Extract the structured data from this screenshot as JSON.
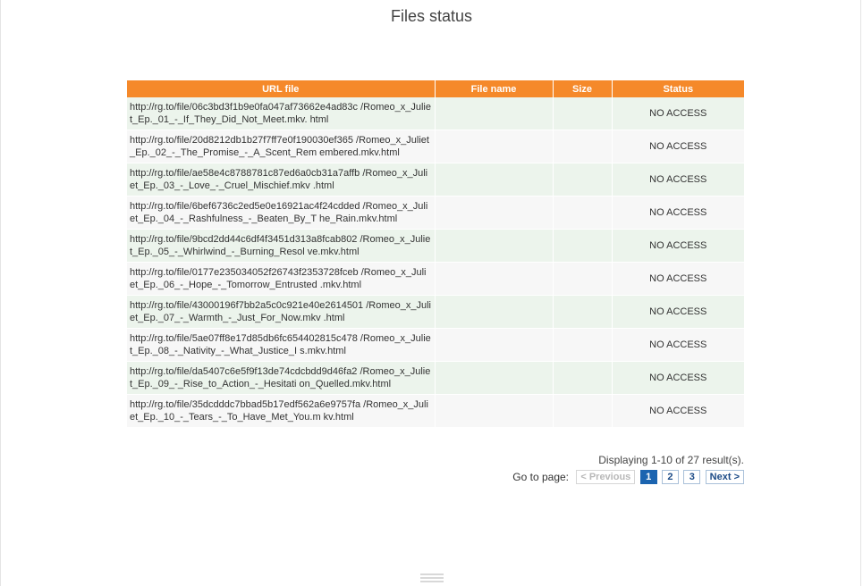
{
  "page": {
    "title": "Files status"
  },
  "table": {
    "headers": {
      "url": "URL file",
      "name": "File name",
      "size": "Size",
      "status": "Status"
    },
    "rows": [
      {
        "url": "http://rg.to/file/06c3bd3f1b9e0fa047af73662e4ad83c /Romeo_x_Juliet_Ep._01_-_If_They_Did_Not_Meet.mkv. html",
        "name": "",
        "size": "",
        "status": "NO ACCESS"
      },
      {
        "url": "http://rg.to/file/20d8212db1b27f7ff7e0f190030ef365 /Romeo_x_Juliet_Ep._02_-_The_Promise_-_A_Scent_Rem embered.mkv.html",
        "name": "",
        "size": "",
        "status": "NO ACCESS"
      },
      {
        "url": "http://rg.to/file/ae58e4c8788781c87ed6a0cb31a7affb /Romeo_x_Juliet_Ep._03_-_Love_-_Cruel_Mischief.mkv .html",
        "name": "",
        "size": "",
        "status": "NO ACCESS"
      },
      {
        "url": "http://rg.to/file/6bef6736c2ed5e0e16921ac4f24cdded /Romeo_x_Juliet_Ep._04_-_Rashfulness_-_Beaten_By_T he_Rain.mkv.html",
        "name": "",
        "size": "",
        "status": "NO ACCESS"
      },
      {
        "url": "http://rg.to/file/9bcd2dd44c6df4f3451d313a8fcab802 /Romeo_x_Juliet_Ep._05_-_Whirlwind_-_Burning_Resol ve.mkv.html",
        "name": "",
        "size": "",
        "status": "NO ACCESS"
      },
      {
        "url": "http://rg.to/file/0177e235034052f26743f2353728fceb /Romeo_x_Juliet_Ep._06_-_Hope_-_Tomorrow_Entrusted .mkv.html",
        "name": "",
        "size": "",
        "status": "NO ACCESS"
      },
      {
        "url": "http://rg.to/file/43000196f7bb2a5c0c921e40e2614501 /Romeo_x_Juliet_Ep._07_-_Warmth_-_Just_For_Now.mkv .html",
        "name": "",
        "size": "",
        "status": "NO ACCESS"
      },
      {
        "url": "http://rg.to/file/5ae07ff8e17d85db6fc654402815c478 /Romeo_x_Juliet_Ep._08_-_Nativity_-_What_Justice_I s.mkv.html",
        "name": "",
        "size": "",
        "status": "NO ACCESS"
      },
      {
        "url": "http://rg.to/file/da5407c6e5f9f13de74cdcbdd9d46fa2 /Romeo_x_Juliet_Ep._09_-_Rise_to_Action_-_Hesitati on_Quelled.mkv.html",
        "name": "",
        "size": "",
        "status": "NO ACCESS"
      },
      {
        "url": "http://rg.to/file/35dcdddc7bbad5b17edf562a6e9757fa /Romeo_x_Juliet_Ep._10_-_Tears_-_To_Have_Met_You.m kv.html",
        "name": "",
        "size": "",
        "status": "NO ACCESS"
      }
    ]
  },
  "pagination": {
    "summary": "Displaying 1-10 of 27 result(s).",
    "goto_label": "Go to page:",
    "previous": "< Previous",
    "pages": [
      "1",
      "2",
      "3"
    ],
    "current_page": "1",
    "next": "Next >"
  },
  "colors": {
    "header_bg": "#f5892a",
    "odd_row_bg": "#ecf4ec",
    "even_row_bg": "#f7f7f7",
    "status_text": "#e3111c",
    "pager_current_bg": "#1b64b0"
  }
}
